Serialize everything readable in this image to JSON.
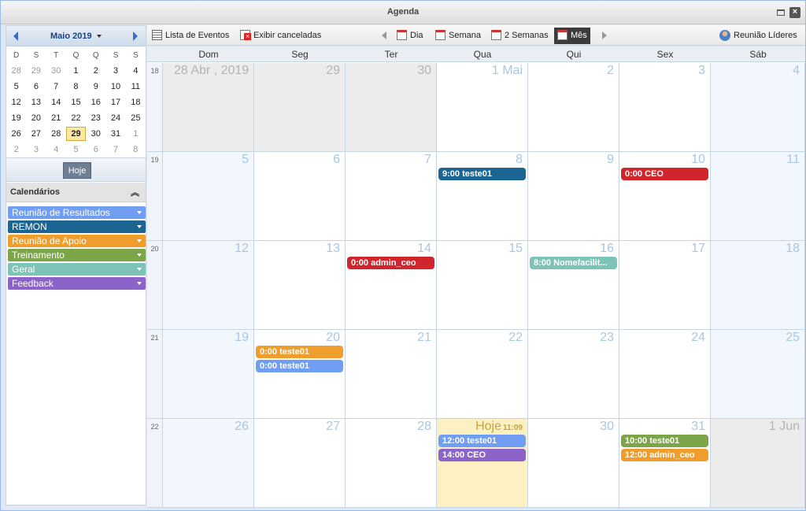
{
  "window": {
    "title": "Agenda"
  },
  "mini_calendar": {
    "month_label": "Maio 2019",
    "dow": [
      "D",
      "S",
      "T",
      "Q",
      "Q",
      "S",
      "S"
    ],
    "weeks": [
      [
        "28",
        "29",
        "30",
        "1",
        "2",
        "3",
        "4"
      ],
      [
        "5",
        "6",
        "7",
        "8",
        "9",
        "10",
        "11"
      ],
      [
        "12",
        "13",
        "14",
        "15",
        "16",
        "17",
        "18"
      ],
      [
        "19",
        "20",
        "21",
        "22",
        "23",
        "24",
        "25"
      ],
      [
        "26",
        "27",
        "28",
        "29",
        "30",
        "31",
        "1"
      ],
      [
        "2",
        "3",
        "4",
        "5",
        "6",
        "7",
        "8"
      ]
    ],
    "today_label": "Hoje"
  },
  "calendars": {
    "title": "Calendários",
    "items": [
      {
        "label": "Reunião de Resultados",
        "color": "#6f9ef2"
      },
      {
        "label": "REMON",
        "color": "#1c6593"
      },
      {
        "label": "Reunião de Apoio",
        "color": "#ef9e2d"
      },
      {
        "label": "Treinamento",
        "color": "#7ba547"
      },
      {
        "label": "Geral",
        "color": "#7ec3b7"
      },
      {
        "label": "Feedback",
        "color": "#8c63c9"
      }
    ]
  },
  "toolbar": {
    "event_list": "Lista de Eventos",
    "show_cancelled": "Exibir canceladas",
    "day": "Dia",
    "week": "Semana",
    "two_weeks": "2 Semanas",
    "month": "Mês",
    "calendar_filter": "Reunião Líderes"
  },
  "month_view": {
    "dow": [
      "Dom",
      "Seg",
      "Ter",
      "Qua",
      "Qui",
      "Sex",
      "Sáb"
    ],
    "weeks": [
      {
        "num": "18",
        "days": [
          "28 Abr , 2019",
          "29",
          "30",
          "1 Mai",
          "2",
          "3",
          "4"
        ]
      },
      {
        "num": "19",
        "days": [
          "5",
          "6",
          "7",
          "8",
          "9",
          "10",
          "11"
        ]
      },
      {
        "num": "20",
        "days": [
          "12",
          "13",
          "14",
          "15",
          "16",
          "17",
          "18"
        ]
      },
      {
        "num": "21",
        "days": [
          "19",
          "20",
          "21",
          "22",
          "23",
          "24",
          "25"
        ]
      },
      {
        "num": "22",
        "days": [
          "26",
          "27",
          "28",
          "Hoje",
          "30",
          "31",
          "1 Jun"
        ]
      }
    ],
    "today_time": "11:09",
    "events": [
      {
        "week": 1,
        "day": 3,
        "slot": 0,
        "label": "9:00 teste01",
        "color": "#1c6593"
      },
      {
        "week": 1,
        "day": 5,
        "slot": 0,
        "label": "0:00 CEO",
        "color": "#d0262b"
      },
      {
        "week": 2,
        "day": 2,
        "slot": 0,
        "label": "0:00 admin_ceo",
        "color": "#d0262b"
      },
      {
        "week": 2,
        "day": 4,
        "slot": 0,
        "label": "8:00 Nomefacilit...",
        "color": "#7ec3b7"
      },
      {
        "week": 3,
        "day": 1,
        "slot": 0,
        "label": "0:00 teste01",
        "color": "#ef9e2d"
      },
      {
        "week": 3,
        "day": 1,
        "slot": 1,
        "label": "0:00 teste01",
        "color": "#6f9ef2"
      },
      {
        "week": 4,
        "day": 3,
        "slot": 0,
        "label": "12:00 teste01",
        "color": "#6f9ef2"
      },
      {
        "week": 4,
        "day": 3,
        "slot": 1,
        "label": "14:00 CEO",
        "color": "#8c63c9"
      },
      {
        "week": 4,
        "day": 5,
        "slot": 0,
        "label": "10:00 teste01",
        "color": "#7ba547"
      },
      {
        "week": 4,
        "day": 5,
        "slot": 1,
        "label": "12:00 admin_ceo",
        "color": "#ef9e2d"
      }
    ]
  }
}
